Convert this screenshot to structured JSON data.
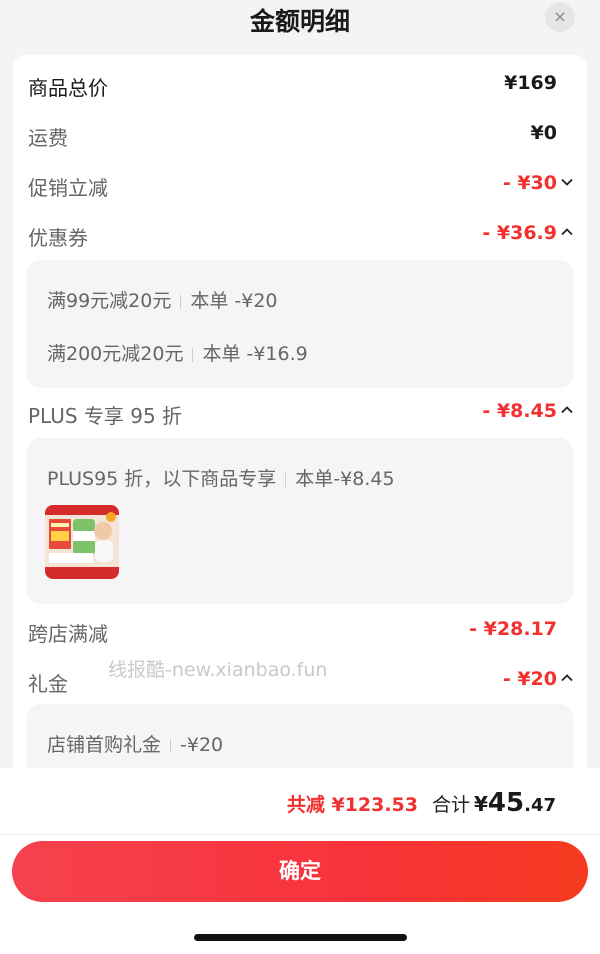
{
  "header": {
    "title": "金额明细",
    "close": "×"
  },
  "rows": {
    "goods": {
      "label": "商品总价",
      "amount": "¥169"
    },
    "shipping": {
      "label": "运费",
      "amount": "¥0"
    },
    "promo": {
      "label": "促销立减",
      "amount": "- ¥30",
      "chevron": "⌄"
    },
    "coupon": {
      "label": "优惠券",
      "amount": "- ¥36.9",
      "chevron": "⌃"
    },
    "plus": {
      "label": "PLUS 专享 95 折",
      "amount": "- ¥8.45",
      "chevron": "⌃"
    },
    "crossstore": {
      "label": "跨店满减",
      "amount": "- ¥28.17"
    },
    "gift": {
      "label": "礼金",
      "amount": "- ¥20",
      "chevron": "⌃"
    }
  },
  "coupon_details": [
    {
      "name": "满99元减20元",
      "value": "本单 -¥20"
    },
    {
      "name": "满200元减20元",
      "value": "本单 -¥16.9"
    }
  ],
  "plus_detail": {
    "name": "PLUS95 折，以下商品专享",
    "value": "本单-¥8.45"
  },
  "gift_detail": {
    "name": "店铺首购礼金",
    "value": "-¥20"
  },
  "watermark": "线报酷-new.xianbao.fun",
  "footer": {
    "saved": "共减 ¥123.53",
    "total_label": "合计",
    "currency": "¥",
    "total_int": "45",
    "total_dec": ".47",
    "confirm": "确定"
  },
  "colors": {
    "accent": "#f23030",
    "button_start": "#f5424e",
    "button_end": "#f53a20"
  }
}
